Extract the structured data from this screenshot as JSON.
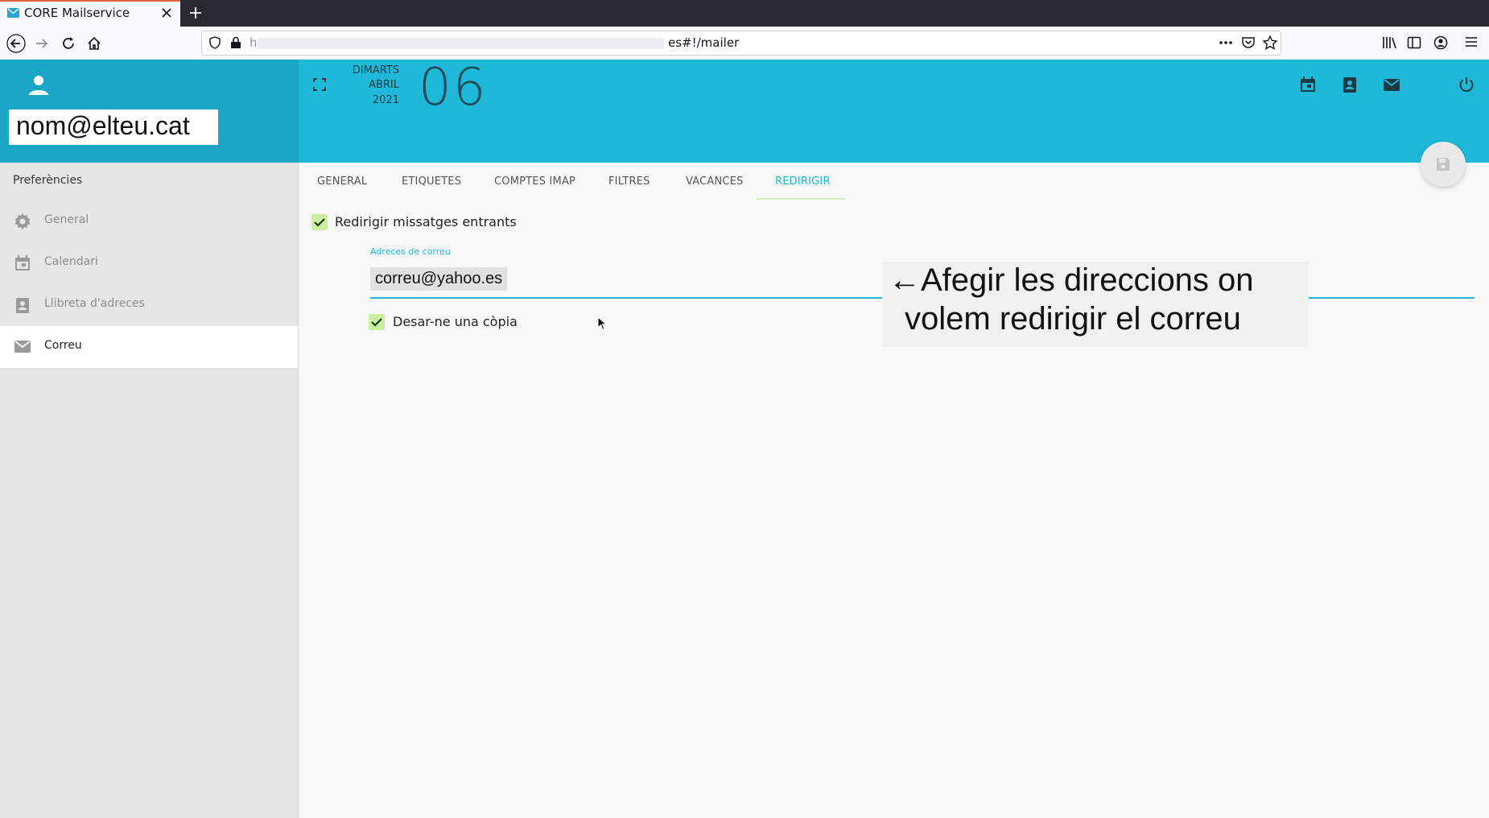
{
  "browser": {
    "tab_title": "CORE Mailservice",
    "url_prefix": "h",
    "url_visible": "es#!/mailer"
  },
  "header": {
    "user_email": "nom@elteu.cat",
    "date": {
      "weekday": "DIMARTS",
      "month": "ABRIL",
      "year": "2021",
      "day": "06"
    }
  },
  "sidebar": {
    "title": "Preferències",
    "items": [
      {
        "label": "General",
        "icon": "gear-icon"
      },
      {
        "label": "Calendari",
        "icon": "calendar-icon"
      },
      {
        "label": "Llibreta d'adreces",
        "icon": "contacts-icon"
      },
      {
        "label": "Correu",
        "icon": "mail-icon",
        "active": true
      }
    ]
  },
  "tabs": [
    "GENERAL",
    "ETIQUETES",
    "COMPTES IMAP",
    "FILTRES",
    "VACANCES",
    "REDIRIGIR"
  ],
  "active_tab": "REDIRIGIR",
  "form": {
    "redirect_label": "Redirigir missatges entrants",
    "redirect_checked": true,
    "addresses_label": "Adreces de correu",
    "addresses": [
      "correu@yahoo.es"
    ],
    "keep_copy_label": "Desar-ne una còpia",
    "keep_copy_checked": true
  },
  "overlay": {
    "line1": "←Afegir les direccions on",
    "line2": "volem redirigir el correu"
  },
  "colors": {
    "accent": "#1eb8d8",
    "sidebar_header": "#1ba6c6",
    "checkbox": "#cdeea0"
  }
}
